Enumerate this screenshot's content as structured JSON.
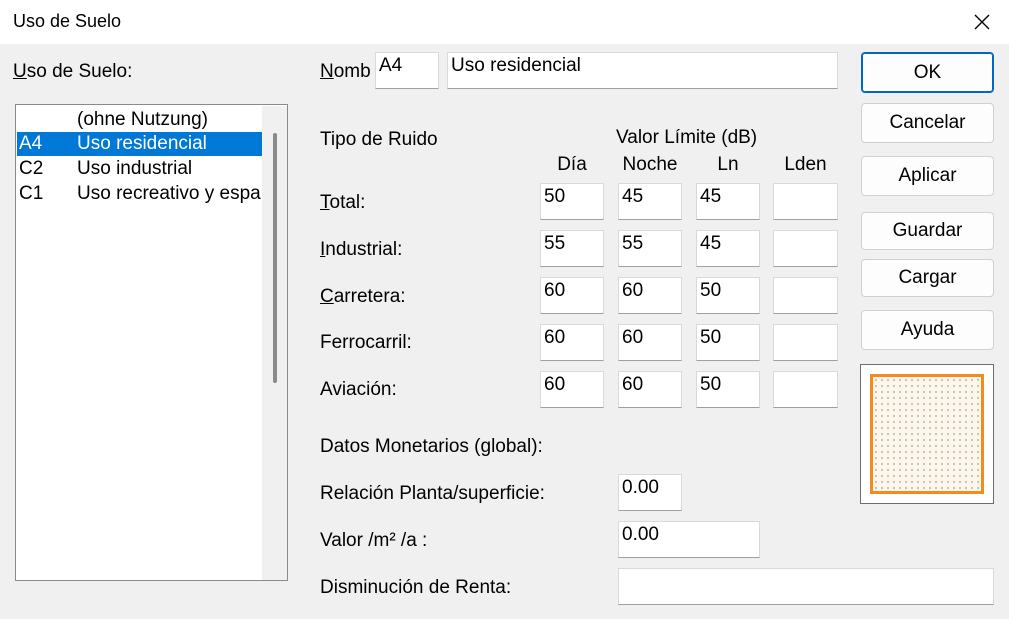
{
  "window": {
    "title": "Uso de Suelo"
  },
  "list": {
    "label_u": "U",
    "label_rest": "so de Suelo:",
    "items": [
      {
        "code": "",
        "name": "(ohne Nutzung)"
      },
      {
        "code": "A4",
        "name": "Uso residencial"
      },
      {
        "code": "C2",
        "name": "Uso industrial"
      },
      {
        "code": "C1",
        "name": "Uso recreativo y esparcimiento"
      }
    ],
    "selected_index": 1
  },
  "nombre": {
    "label_u": "N",
    "label_rest": "ombre:",
    "code": "A4",
    "name": "Uso residencial"
  },
  "noise": {
    "tipo_label": "Tipo de Ruido",
    "valor_label": "Valor Límite (dB)",
    "col_dia": "Día",
    "col_noche": "Noche",
    "col_ln": "Ln",
    "col_lden": "Lden",
    "rows": [
      {
        "u": "T",
        "rest": "otal:",
        "dia": "50",
        "noche": "45",
        "ln": "45",
        "lden": ""
      },
      {
        "u": "I",
        "rest": "ndustrial:",
        "dia": "55",
        "noche": "55",
        "ln": "45",
        "lden": ""
      },
      {
        "u": "C",
        "rest": "arretera:",
        "dia": "60",
        "noche": "60",
        "ln": "50",
        "lden": ""
      },
      {
        "u": "",
        "rest": "Ferrocarril:",
        "dia": "60",
        "noche": "60",
        "ln": "50",
        "lden": ""
      },
      {
        "u": "",
        "rest": "Aviación:",
        "dia": "60",
        "noche": "60",
        "ln": "50",
        "lden": ""
      }
    ]
  },
  "money": {
    "title": "Datos Monetarios (global):",
    "relacion_label": "Relación Planta/superficie:",
    "relacion_value": "0.00",
    "valor_label": "Valor /m² /a :",
    "valor_value": "0.00",
    "renta_label": "Disminución de Renta:",
    "renta_value": ""
  },
  "buttons": {
    "ok": "OK",
    "cancel": "Cancelar",
    "apply": "Aplicar",
    "save": "Guardar",
    "load": "Cargar",
    "help": "Ayuda"
  },
  "colors": {
    "selection": "#0078d7",
    "preview_border": "#f58b1f"
  }
}
